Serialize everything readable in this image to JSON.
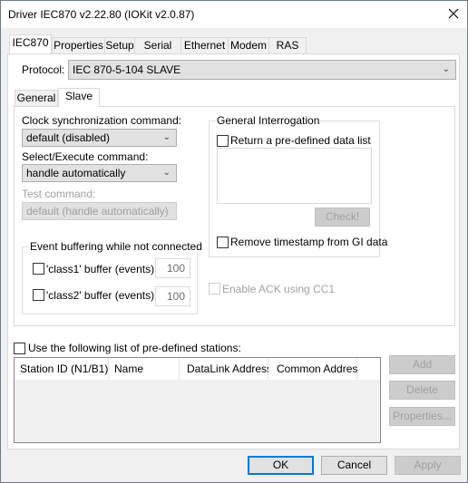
{
  "window": {
    "title": "Driver IEC870 v2.22.80 (IOKit v2.0.87)",
    "close_icon": "close-icon"
  },
  "tabs": [
    "IEC870",
    "Properties",
    "Setup",
    "Serial",
    "Ethernet",
    "Modem",
    "RAS"
  ],
  "protocol": {
    "label": "Protocol:",
    "value": "IEC 870-5-104 SLAVE"
  },
  "subtabs": [
    "General",
    "Slave"
  ],
  "slave": {
    "clock_label": "Clock synchronization command:",
    "clock_value": "default (disabled)",
    "select_label": "Select/Execute command:",
    "select_value": "handle automatically",
    "test_label": "Test command:",
    "test_value": "default (handle automatically)",
    "event_group": "Event buffering while not connected",
    "class1_label": "'class1' buffer (events):",
    "class1_value": "100",
    "class2_label": "'class2' buffer (events):",
    "class2_value": "100",
    "gi_group": "General Interrogation",
    "gi_return_label": "Return a pre-defined data list",
    "check_button": "Check!",
    "remove_ts_label": "Remove timestamp from GI data",
    "enable_ack_label": "Enable ACK using CC1"
  },
  "stations": {
    "checkbox_label": "Use the following list of pre-defined stations:",
    "columns": [
      "Station ID (N1/B1)",
      "Name",
      "DataLink Address",
      "Common Address"
    ],
    "add": "Add",
    "delete": "Delete",
    "properties": "Properties..."
  },
  "footer": {
    "ok": "OK",
    "cancel": "Cancel",
    "apply": "Apply"
  }
}
